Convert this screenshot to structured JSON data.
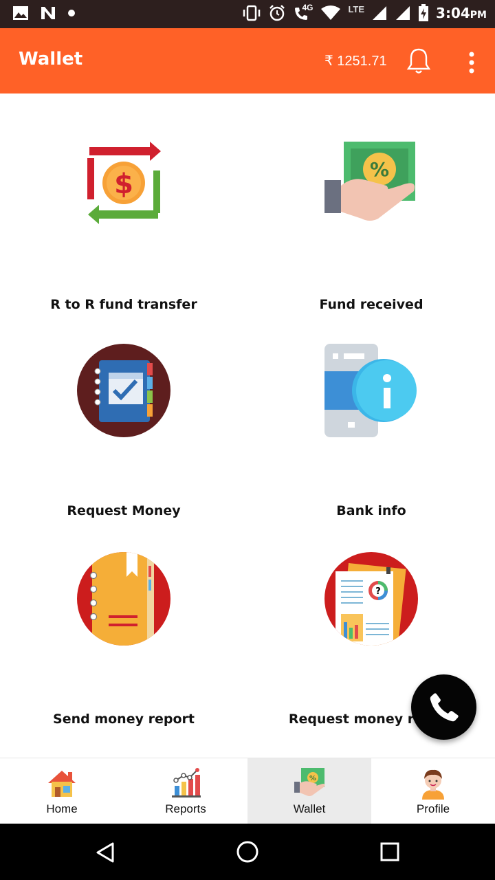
{
  "status_bar": {
    "time": "3:04",
    "ampm": "PM",
    "network": "LTE",
    "network_small": "4G"
  },
  "app_bar": {
    "title": "Wallet",
    "balance": "₹ 1251.71",
    "icons": [
      "bell-icon",
      "more-vert-icon"
    ]
  },
  "tiles": [
    {
      "label": "R to R fund transfer",
      "icon": "fund-transfer-icon"
    },
    {
      "label": "Fund received",
      "icon": "fund-received-icon"
    },
    {
      "label": "Request Money",
      "icon": "request-money-icon"
    },
    {
      "label": "Bank info",
      "icon": "bank-info-icon"
    },
    {
      "label": "Send money report",
      "icon": "send-money-report-icon"
    },
    {
      "label": "Request money report",
      "icon": "request-money-report-icon"
    }
  ],
  "fab": {
    "icon": "phone-icon"
  },
  "bottom_nav": {
    "items": [
      {
        "label": "Home",
        "icon": "home-icon",
        "active": false
      },
      {
        "label": "Reports",
        "icon": "reports-icon",
        "active": false
      },
      {
        "label": "Wallet",
        "icon": "wallet-icon",
        "active": true
      },
      {
        "label": "Profile",
        "icon": "profile-icon",
        "active": false
      }
    ]
  },
  "system_nav": [
    "back-icon",
    "home-circle-icon",
    "recents-icon"
  ],
  "colors": {
    "app_bar": "#ff6127",
    "status_bar": "#2d1f1e",
    "fab": "#050505"
  }
}
